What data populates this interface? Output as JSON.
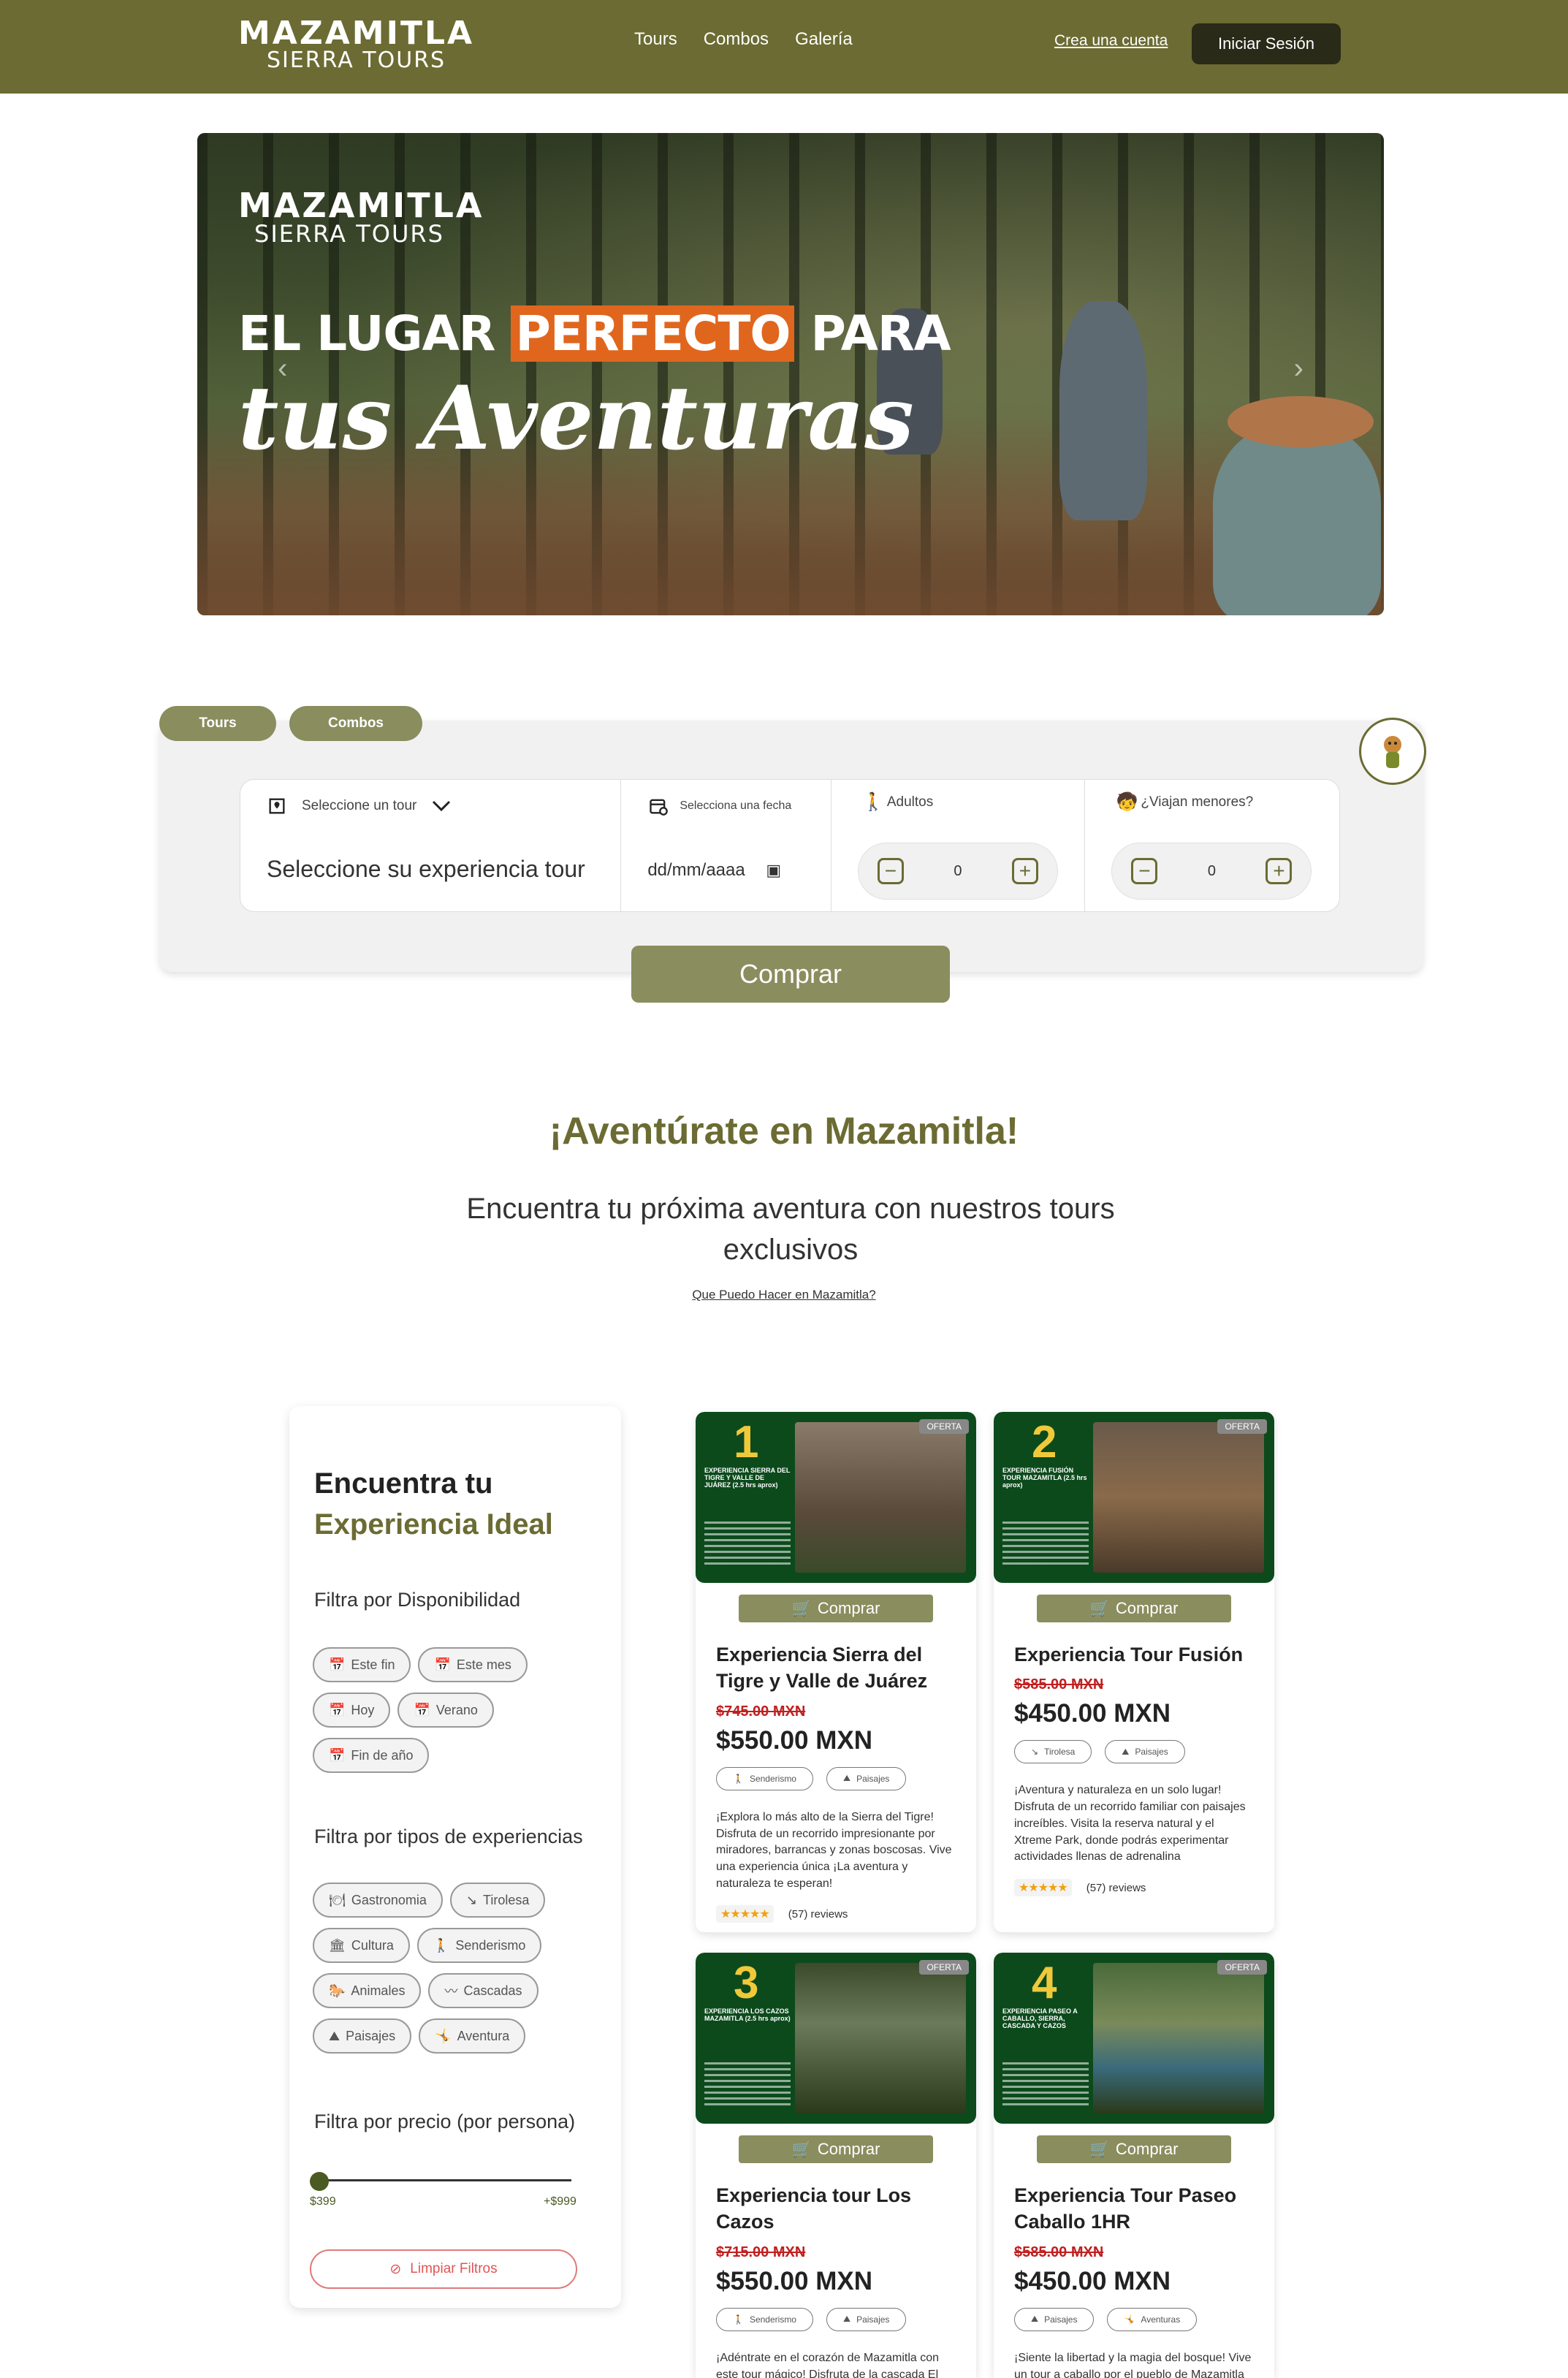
{
  "nav": {
    "logo_top": "MAZAMITLA",
    "logo_bottom": "SIERRA TOURS",
    "links": [
      "Tours",
      "Combos",
      "Galería"
    ],
    "create_account": "Crea una cuenta",
    "login": "Iniciar Sesión"
  },
  "hero": {
    "logo_top": "MAZAMITLA",
    "logo_bottom": "SIERRA TOURS",
    "line1_a": "EL LUGAR ",
    "line1_highlight": "PERFECTO",
    "line1_b": " PARA",
    "line2": "tus Aventuras",
    "prev": "‹",
    "next": "›"
  },
  "booking": {
    "tab_tours": "Tours",
    "tab_combos": "Combos",
    "tour_label": "Seleccione un tour",
    "tour_value": "Seleccione su experiencia tour",
    "date_label": "Selecciona una fecha",
    "date_value": "dd/mm/aaaa",
    "adults_label": "Adultos",
    "adults_value": "0",
    "minors_label": "¿Viajan menores?",
    "minors_value": "0",
    "submit": "Comprar"
  },
  "intro": {
    "title": "¡Aventúrate en Mazamitla!",
    "subtitle": "Encuentra tu próxima aventura con nuestros tours exclusivos",
    "link": "Que Puedo Hacer en Mazamitla?"
  },
  "filter": {
    "title_a": "Encuentra tu",
    "title_b": "Experiencia Ideal",
    "availability_title": "Filtra por Disponibilidad",
    "availability": [
      "Este fin",
      "Este mes",
      "Hoy",
      "Verano",
      "Fin de año"
    ],
    "types_title": "Filtra por tipos de experiencias",
    "types": [
      "Gastronomia",
      "Tirolesa",
      "Cultura",
      "Senderismo",
      "Animales",
      "Cascadas",
      "Paisajes",
      "Aventura"
    ],
    "price_title": "Filtra por precio (por persona)",
    "price_min": "$399",
    "price_max": "+$999",
    "clear": "Limpiar Filtros"
  },
  "cards": [
    {
      "num": "1",
      "mini": "EXPERIENCIA SIERRA DEL TIGRE Y VALLE DE JUÁREZ (2.5 hrs aprox)",
      "oferta": "OFERTA",
      "buy": "Comprar",
      "name": "Experiencia Sierra del Tigre y Valle de Juárez",
      "old_price": "$745.00 MXN",
      "price": "$550.00 MXN",
      "tags": [
        "Senderismo",
        "Paisajes"
      ],
      "desc": "¡Explora lo más alto de la Sierra del Tigre! Disfruta de un recorrido impresionante por miradores, barrancas y zonas boscosas. Vive una experiencia única ¡La aventura y naturaleza te esperan!",
      "stars": "★★★★★",
      "reviews": "(57) reviews"
    },
    {
      "num": "2",
      "mini": "EXPERIENCIA FUSIÓN TOUR MAZAMITLA (2.5 hrs aprox)",
      "oferta": "OFERTA",
      "buy": "Comprar",
      "name": "Experiencia Tour Fusión",
      "old_price": "$585.00 MXN",
      "price": "$450.00 MXN",
      "tags": [
        "Tirolesa",
        "Paisajes"
      ],
      "desc": "¡Aventura y naturaleza en un solo lugar! Disfruta de un recorrido familiar con paisajes increíbles. Visita la reserva natural y el Xtreme Park, donde podrás experimentar actividades llenas de adrenalina",
      "stars": "★★★★★",
      "reviews": "(57) reviews"
    },
    {
      "num": "3",
      "mini": "EXPERIENCIA LOS CAZOS MAZAMITLA (2.5 hrs aprox)",
      "oferta": "OFERTA",
      "buy": "Comprar",
      "name": "Experiencia tour Los Cazos",
      "old_price": "$715.00 MXN",
      "price": "$550.00 MXN",
      "tags": [
        "Senderismo",
        "Paisajes"
      ],
      "desc": "¡Adéntrate en el corazón de Mazamitla con este tour mágico! Disfruta de la cascada El Salto y un",
      "stars": "",
      "reviews": ""
    },
    {
      "num": "4",
      "mini": "EXPERIENCIA PASEO A CABALLO, SIERRA, CASCADA Y CAZOS",
      "oferta": "OFERTA",
      "buy": "Comprar",
      "name": "Experiencia Tour Paseo Caballo 1HR",
      "old_price": "$585.00 MXN",
      "price": "$450.00 MXN",
      "tags": [
        "Paisajes",
        "Aventuras"
      ],
      "desc": "¡Siente la libertad y la magia del bosque! Vive un tour a caballo por el pueblo de Mazamitla",
      "stars": "",
      "reviews": ""
    }
  ],
  "colors": {
    "brand": "#6b6b33",
    "button": "#8a8d5e",
    "card_image_bg": "#0c4a1c",
    "strike_red": "#c02020"
  }
}
